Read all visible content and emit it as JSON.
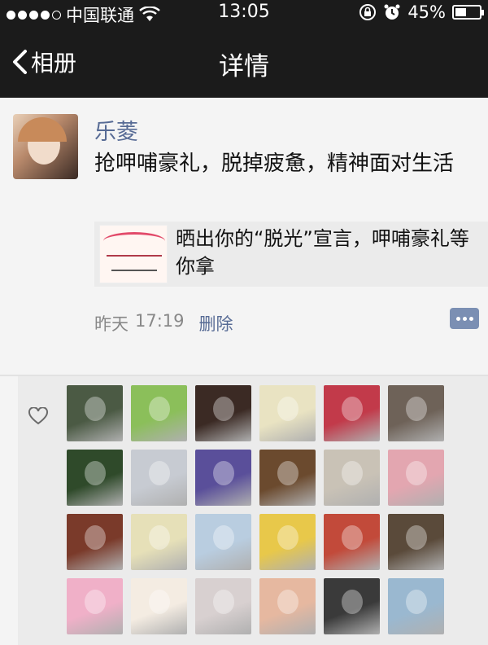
{
  "status_bar": {
    "carrier": "中国联通",
    "time": "13:05",
    "battery_percent": "45%",
    "battery_level": 0.45,
    "signal_bars_filled": 4,
    "signal_bars_total": 5
  },
  "nav": {
    "back_label": "相册",
    "title": "详情"
  },
  "post": {
    "author": "乐菱",
    "text": "抢呷哺豪礼，脱掉疲惫，精神面对生活",
    "share": {
      "text": "晒出你的“脱光”宣言，呷哺豪礼等你拿"
    },
    "time_label": "昨天",
    "time": "17:19",
    "delete_label": "删除"
  },
  "likes": {
    "icon": "heart-outline-icon",
    "avatar_count": 24,
    "avatar_colors": [
      "#4b5a44",
      "#8bbf5a",
      "#3b2a24",
      "#e9e3c2",
      "#c23a4a",
      "#6e6258",
      "#2f4a2a",
      "#c7cbd2",
      "#5a4f9a",
      "#6b4a2e",
      "#c9c2b6",
      "#e3a6b0",
      "#7a3a2a",
      "#e6e0b8",
      "#b9cde0",
      "#e8c84a",
      "#c24a3a",
      "#5a4a3a",
      "#f0b0c8",
      "#f4ece2",
      "#d8d0d0",
      "#e6b8a0",
      "#3a3a3a",
      "#9ab8d0"
    ]
  },
  "colors": {
    "bar_bg": "#1b1b1b",
    "link": "#576b95",
    "page_bg": "#f4f4f4",
    "likes_bg": "#ebebeb"
  }
}
